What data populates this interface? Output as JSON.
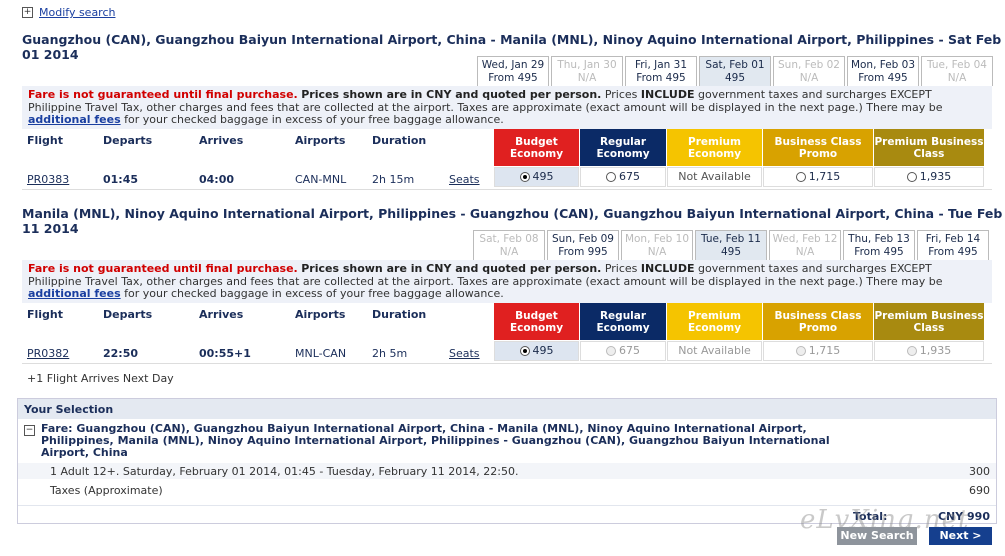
{
  "modify_search": "Modify search",
  "outbound": {
    "title": "Guangzhou (CAN), Guangzhou Baiyun International Airport, China - Manila (MNL), Ninoy Aquino International Airport, Philippines - Sat Feb 01 2014",
    "tabs": [
      {
        "date": "Wed, Jan 29",
        "price": "From 495",
        "state": "act"
      },
      {
        "date": "Thu, Jan 30",
        "price": "N/A",
        "state": "dis"
      },
      {
        "date": "Fri, Jan 31",
        "price": "From 495",
        "state": "act"
      },
      {
        "date": "Sat, Feb 01",
        "price": "495",
        "state": "sel"
      },
      {
        "date": "Sun, Feb 02",
        "price": "N/A",
        "state": "dis"
      },
      {
        "date": "Mon, Feb 03",
        "price": "From 495",
        "state": "act"
      },
      {
        "date": "Tue, Feb 04",
        "price": "N/A",
        "state": "dis"
      }
    ],
    "flight": {
      "number": "PR0383",
      "departs": "01:45",
      "arrives": "04:00",
      "airports": "CAN-MNL",
      "duration": "2h 15m",
      "seats": "Seats"
    },
    "options": [
      "495",
      "675",
      "Not Available",
      "1,715",
      "1,935"
    ]
  },
  "inbound": {
    "title": "Manila (MNL), Ninoy Aquino International Airport, Philippines - Guangzhou (CAN), Guangzhou Baiyun International Airport, China - Tue Feb 11 2014",
    "tabs": [
      {
        "date": "Sat, Feb 08",
        "price": "N/A",
        "state": "dis"
      },
      {
        "date": "Sun, Feb 09",
        "price": "From 995",
        "state": "act"
      },
      {
        "date": "Mon, Feb 10",
        "price": "N/A",
        "state": "dis"
      },
      {
        "date": "Tue, Feb 11",
        "price": "495",
        "state": "sel"
      },
      {
        "date": "Wed, Feb 12",
        "price": "N/A",
        "state": "dis"
      },
      {
        "date": "Thu, Feb 13",
        "price": "From 495",
        "state": "act"
      },
      {
        "date": "Fri, Feb 14",
        "price": "From 495",
        "state": "act"
      }
    ],
    "flight": {
      "number": "PR0382",
      "departs": "22:50",
      "arrives": "00:55+1",
      "airports": "MNL-CAN",
      "duration": "2h 5m",
      "seats": "Seats"
    },
    "options": [
      "495",
      "675",
      "Not Available",
      "1,715",
      "1,935"
    ],
    "footnote": "+1 Flight Arrives Next Day"
  },
  "notice": {
    "red": "Fare is not guaranteed until final purchase.",
    "bold": "Prices shown are in CNY and quoted per person.",
    "text1": "Prices",
    "include": "INCLUDE",
    "text2": "government taxes and surcharges EXCEPT Philippine Travel Tax, other charges and fees that are collected at the airport. Taxes are approximate (exact amount will be displayed in the next page.) There may be",
    "link": "additional fees",
    "text3": "for your checked baggage in excess of your free baggage allowance."
  },
  "columns": {
    "flight": "Flight",
    "departs": "Departs",
    "arrives": "Arrives",
    "airports": "Airports",
    "duration": "Duration"
  },
  "classes": [
    {
      "name": "Budget Economy",
      "color": "#e02020"
    },
    {
      "name": "Regular Economy",
      "color": "#0b2a66"
    },
    {
      "name": "Premium Economy",
      "color": "#f5c400"
    },
    {
      "name": "Business Class Promo",
      "color": "#d8a200"
    },
    {
      "name": "Premium Business Class",
      "color": "#a88a10"
    }
  ],
  "selection": {
    "title": "Your Selection",
    "fare_label": "Fare: Guangzhou (CAN), Guangzhou Baiyun International Airport, China - Manila (MNL), Ninoy Aquino International Airport, Philippines, Manila (MNL), Ninoy Aquino International Airport, Philippines - Guangzhou (CAN), Guangzhou Baiyun International Airport, China",
    "pax_line": "1 Adult 12+. Saturday, February 01 2014, 01:45 - Tuesday, February 11 2014, 22:50.",
    "pax_amount": "300",
    "tax_label": "Taxes (Approximate)",
    "tax_amount": "690",
    "total_label": "Total:",
    "total_value": "CNY 990"
  },
  "buttons": {
    "new_search": "New Search",
    "next": "Next >"
  },
  "watermark": "eLvXing.net"
}
